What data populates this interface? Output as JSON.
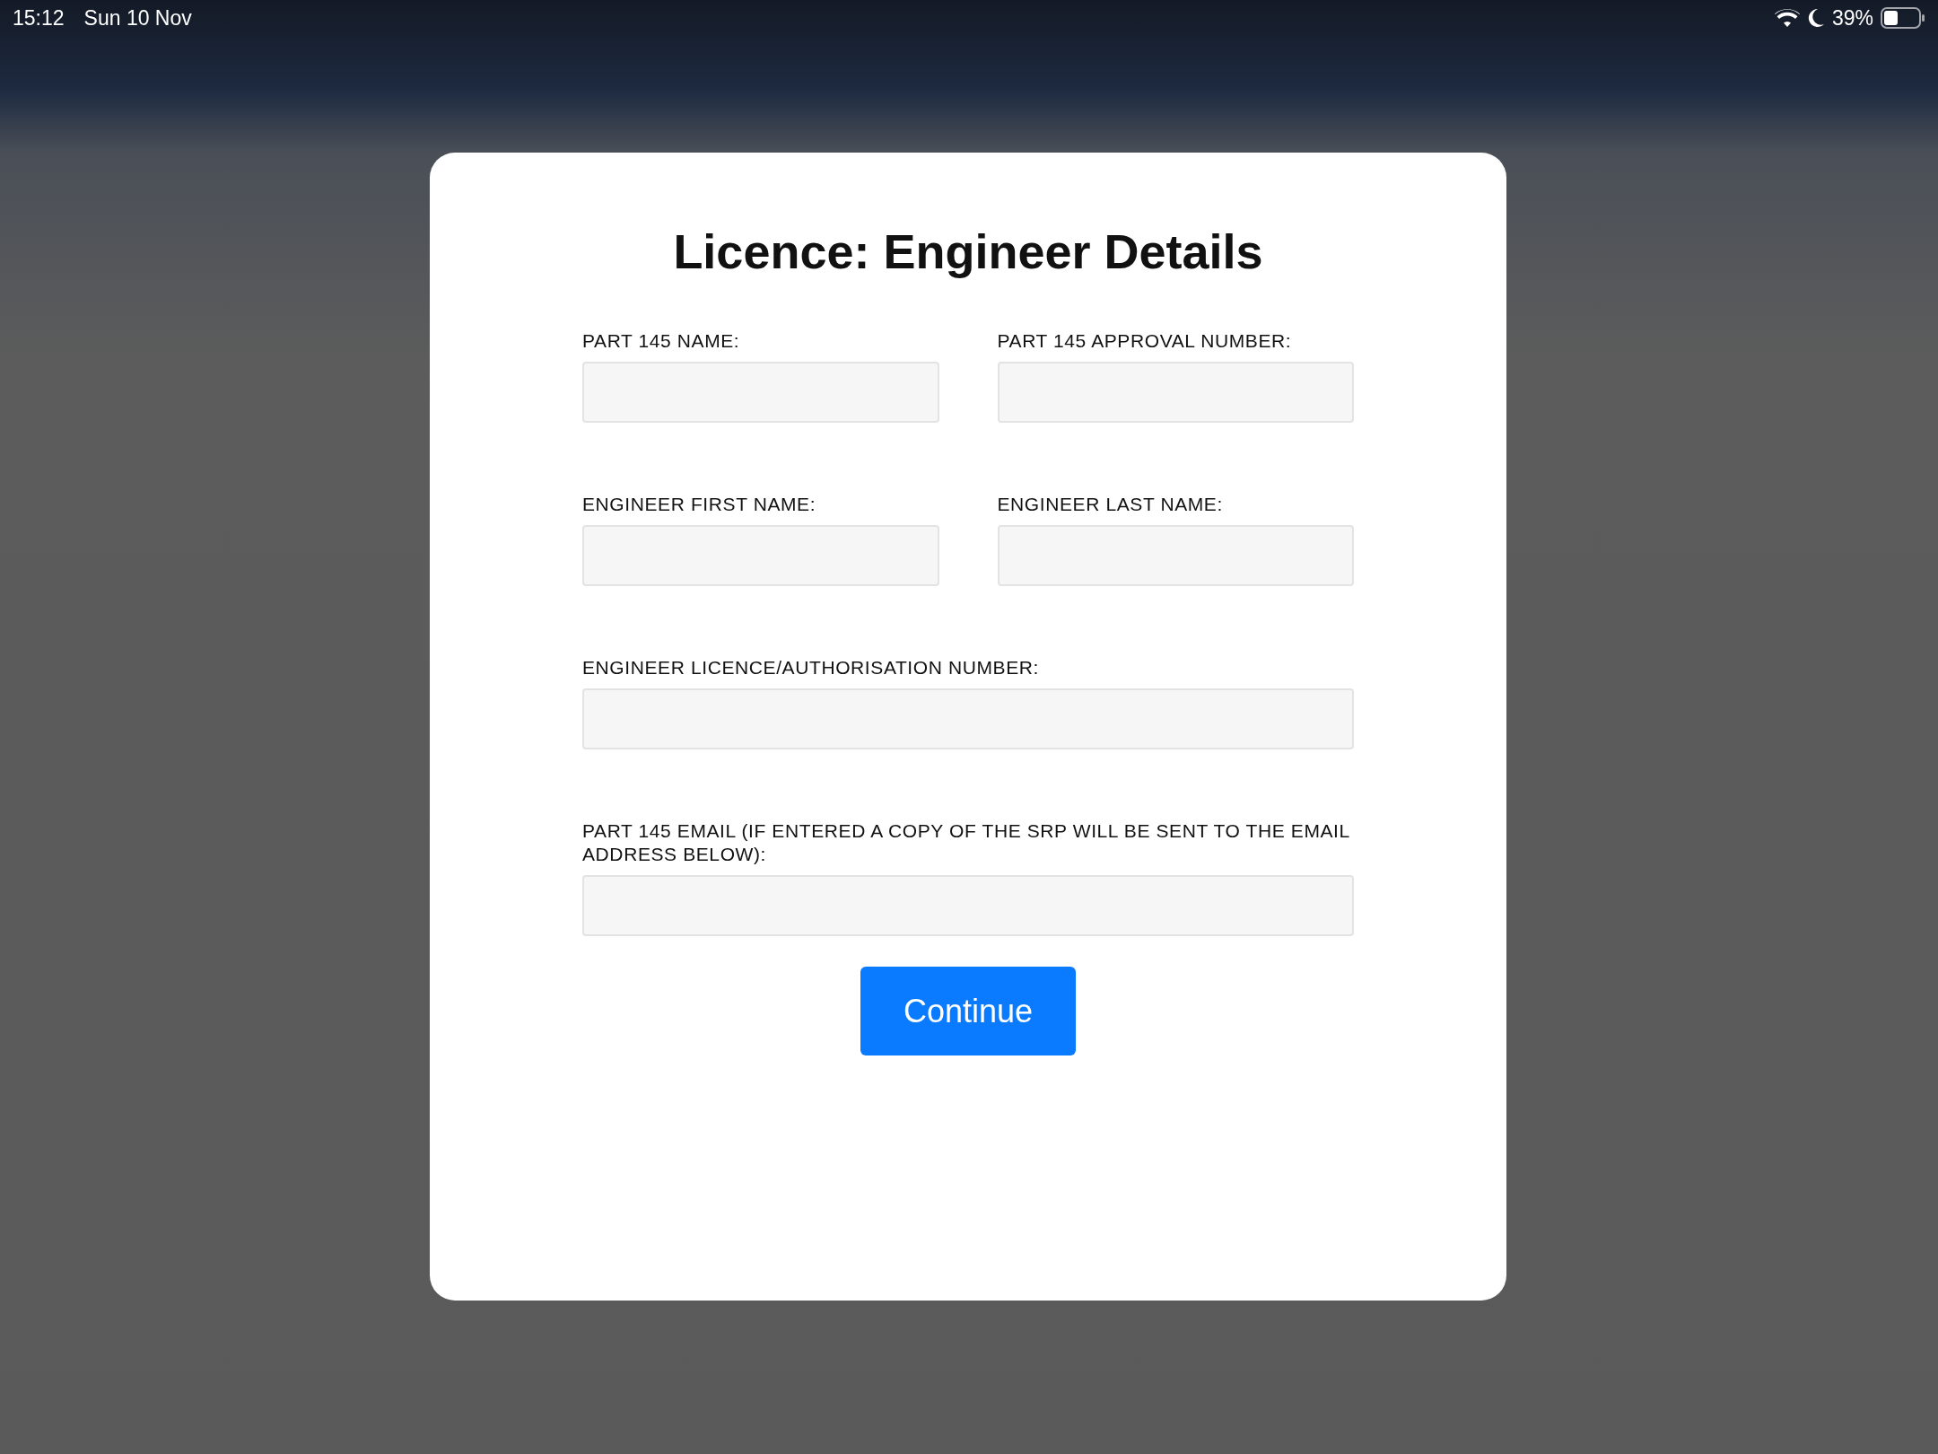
{
  "status_bar": {
    "time": "15:12",
    "date": "Sun 10 Nov",
    "battery": "39%"
  },
  "dialog": {
    "title": "Licence: Engineer Details",
    "fields": [
      {
        "label": "PART 145 NAME:",
        "kind": "half"
      },
      {
        "label": "PART 145 APPROVAL NUMBER:",
        "kind": "half"
      },
      {
        "label": "ENGINEER FIRST NAME:",
        "kind": "half"
      },
      {
        "label": "ENGINEER LAST NAME:",
        "kind": "half"
      },
      {
        "label": "ENGINEER LICENCE/AUTHORISATION NUMBER:",
        "kind": "full"
      },
      {
        "label": "PART 145 EMAIL (IF ENTERED A COPY OF THE SRP WILL BE SENT TO THE EMAIL ADDRESS BELOW):",
        "kind": "full"
      }
    ],
    "button": "Continue"
  }
}
